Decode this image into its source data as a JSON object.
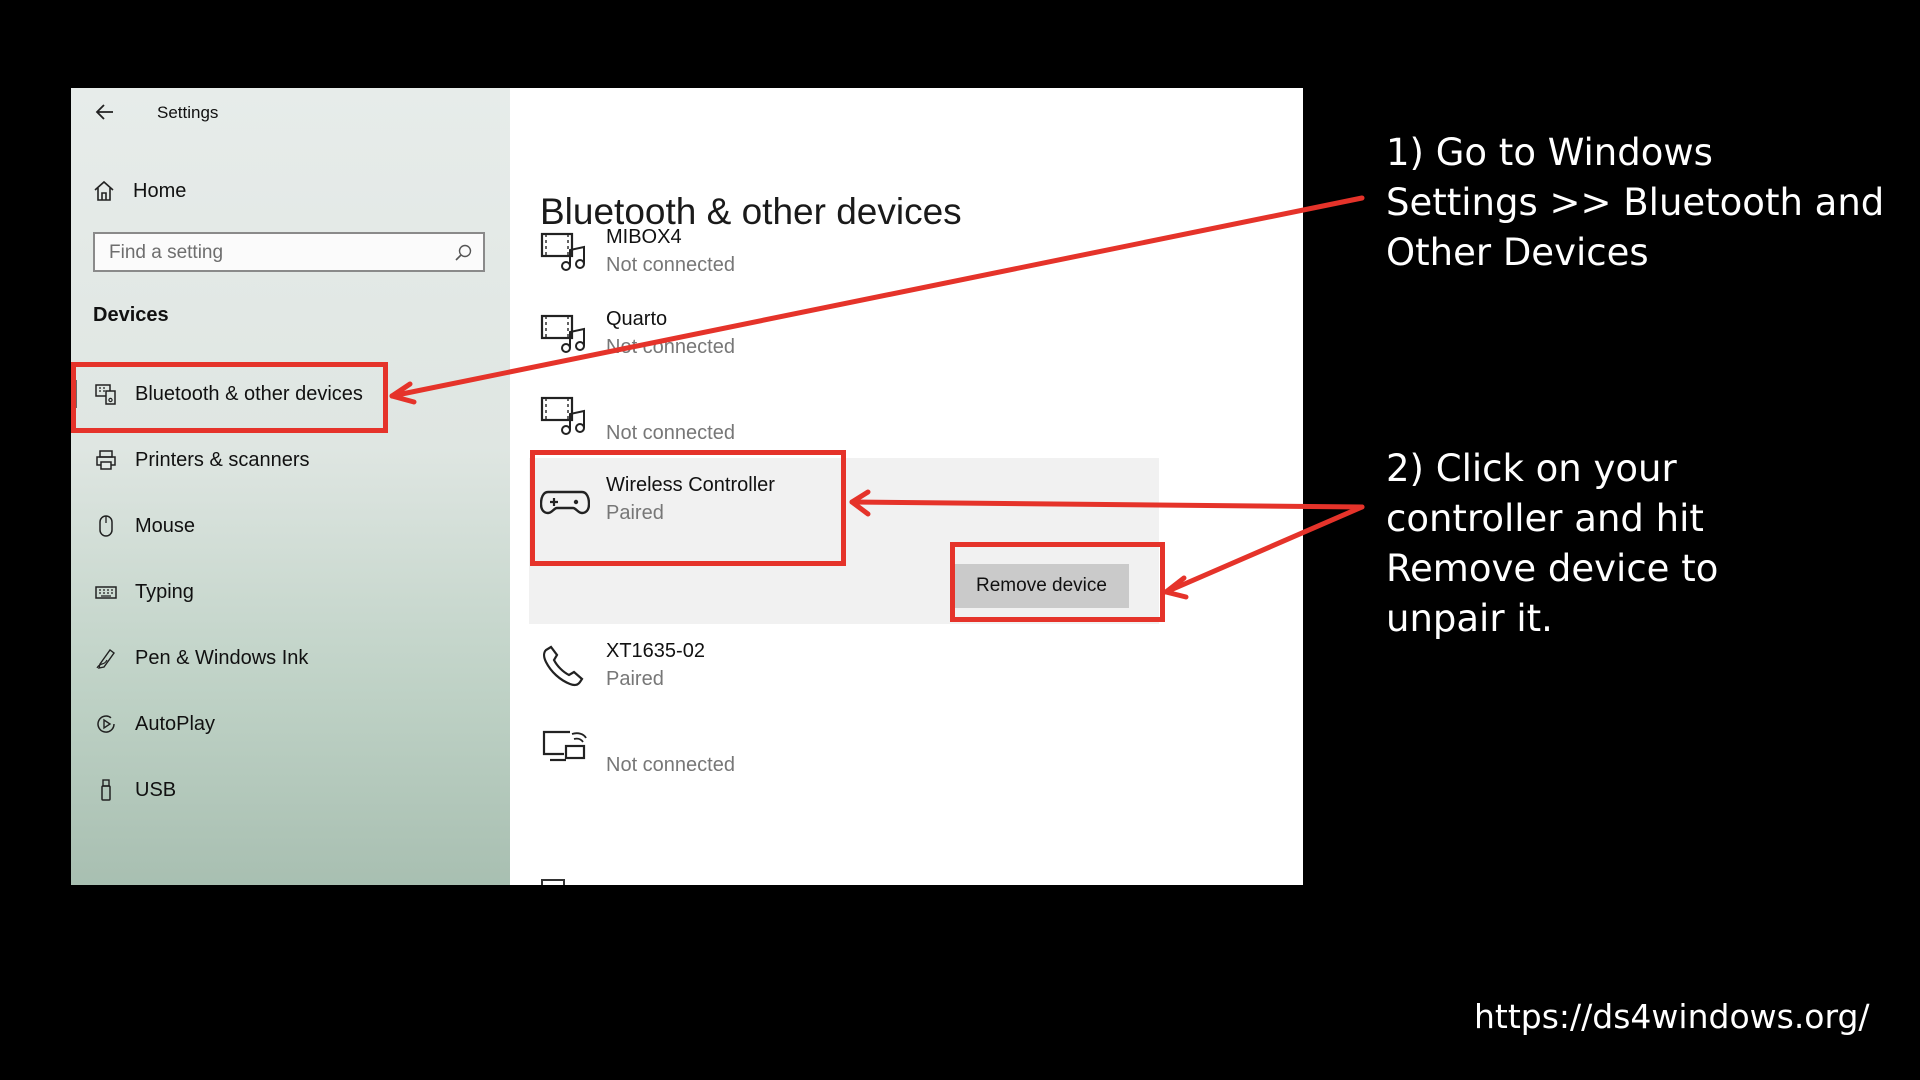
{
  "window": {
    "title": "Settings",
    "sidebar": {
      "home_label": "Home",
      "search_placeholder": "Find a setting",
      "section_title": "Devices",
      "items": [
        {
          "label": "Bluetooth & other devices",
          "icon": "bluetooth-devices-icon",
          "selected": true
        },
        {
          "label": "Printers & scanners",
          "icon": "printer-icon"
        },
        {
          "label": "Mouse",
          "icon": "mouse-icon"
        },
        {
          "label": "Typing",
          "icon": "keyboard-icon"
        },
        {
          "label": "Pen & Windows Ink",
          "icon": "pen-icon"
        },
        {
          "label": "AutoPlay",
          "icon": "autoplay-icon"
        },
        {
          "label": "USB",
          "icon": "usb-icon"
        }
      ]
    },
    "content": {
      "title": "Bluetooth & other devices",
      "devices": [
        {
          "name": "MIBOX4",
          "status": "Not connected",
          "icon": "media-device-icon"
        },
        {
          "name": "Quarto",
          "status": "Not connected",
          "icon": "media-device-icon"
        },
        {
          "name": "",
          "status": "Not connected",
          "icon": "media-device-icon"
        },
        {
          "name": "Wireless Controller",
          "status": "Paired",
          "icon": "gamepad-icon"
        },
        {
          "name": "XT1635-02",
          "status": "Paired",
          "icon": "phone-icon"
        },
        {
          "name": "",
          "status": "Not connected",
          "icon": "display-device-icon"
        }
      ],
      "remove_button_label": "Remove device"
    }
  },
  "annotations": {
    "step1_lines": [
      "1) Go to Windows",
      "Settings >> Bluetooth and",
      "Other Devices"
    ],
    "step2_lines": [
      "2) Click on your",
      "controller and hit",
      "Remove device to",
      "unpair it."
    ],
    "url": "https://ds4windows.org/"
  },
  "colors": {
    "highlight": "#e5332a",
    "background": "#000000",
    "annotation_text": "#ffffff"
  }
}
